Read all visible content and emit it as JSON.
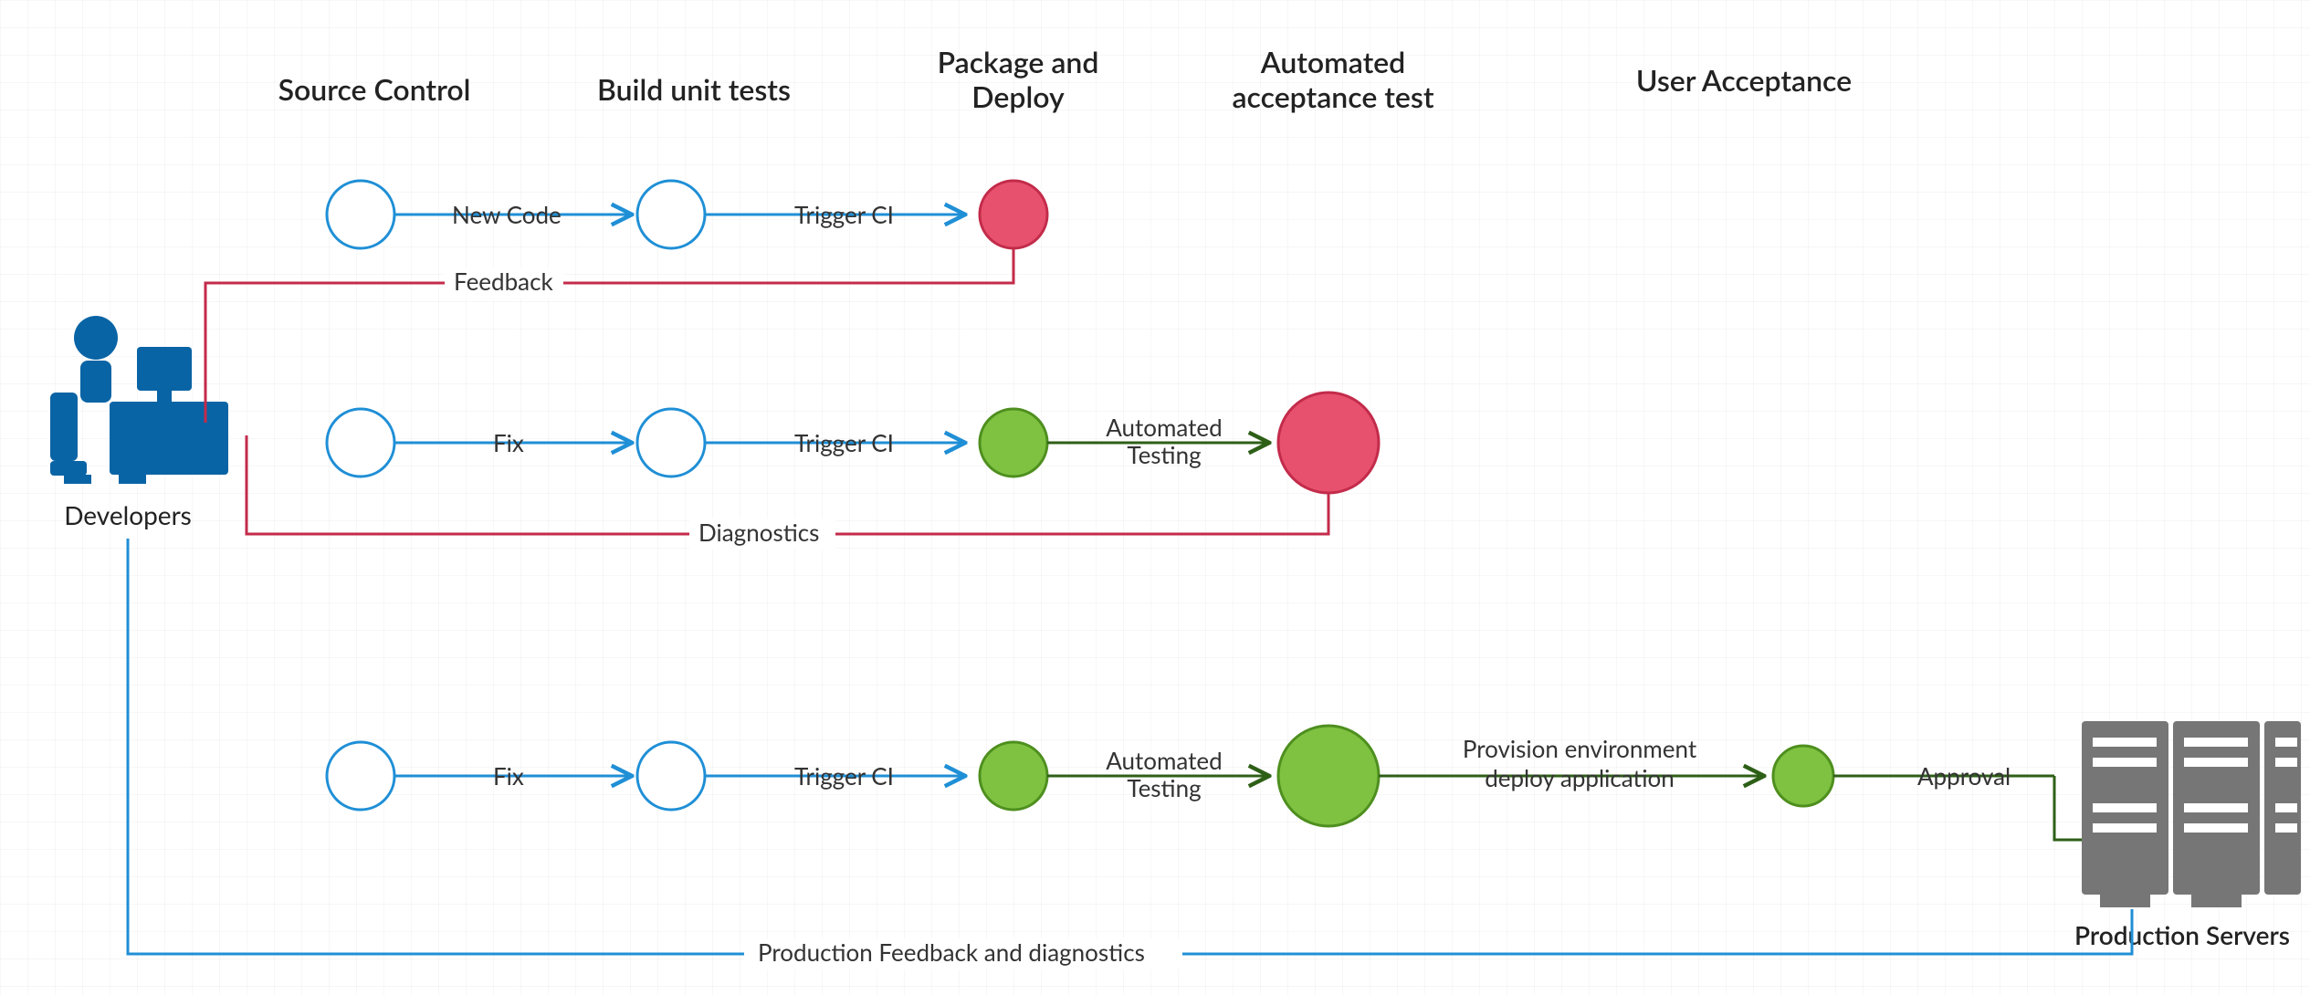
{
  "columns": {
    "source_control": "Source Control",
    "build_unit_tests": "Build unit tests",
    "package_deploy_l1": "Package and",
    "package_deploy_l2": "Deploy",
    "auto_accept_l1": "Automated",
    "auto_accept_l2": "acceptance test",
    "user_acceptance": "User Acceptance"
  },
  "actors": {
    "developers": "Developers",
    "production_servers": "Production Servers"
  },
  "edges": {
    "new_code": "New Code",
    "trigger_ci": "Trigger CI",
    "feedback": "Feedback",
    "fix": "Fix",
    "automated_testing_l1": "Automated",
    "automated_testing_l2": "Testing",
    "diagnostics": "Diagnostics",
    "provision_l1": "Provision environment",
    "provision_l2": "deploy application",
    "approval": "Approval",
    "prod_feedback": "Production Feedback and diagnostics"
  },
  "colors": {
    "blue": "#1f8fd6",
    "blue_dark": "#0964a5",
    "red_fill": "#e7516e",
    "red_stroke": "#c32b4a",
    "green_fill": "#7fc241",
    "green_stroke": "#4e8f1f",
    "dark_green": "#2e5f17",
    "grey": "#767676"
  }
}
